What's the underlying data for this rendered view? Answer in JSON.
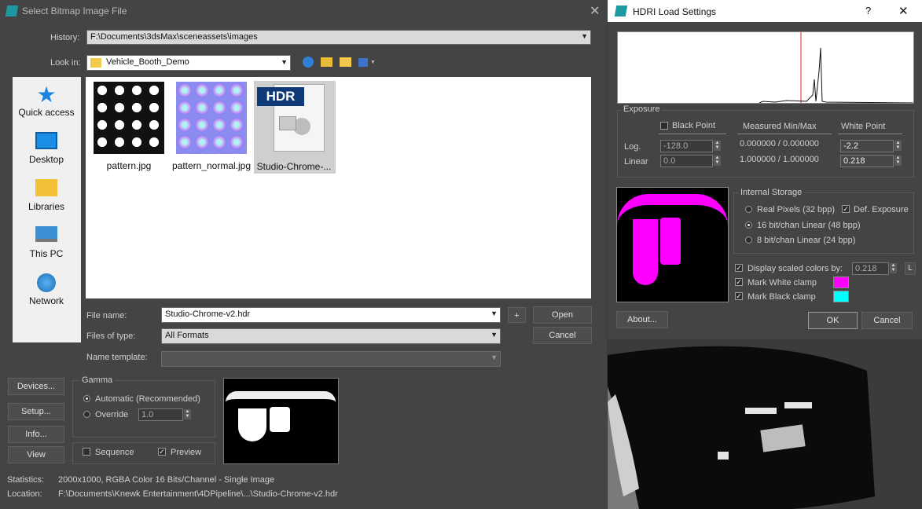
{
  "file_dialog": {
    "title": "Select Bitmap Image File",
    "history_label": "History:",
    "history_value": "F:\\Documents\\3dsMax\\sceneassets\\images",
    "lookin_label": "Look in:",
    "lookin_value": "Vehicle_Booth_Demo",
    "sidebar": [
      {
        "label": "Quick access",
        "icon": "star-icon"
      },
      {
        "label": "Desktop",
        "icon": "desktop-icon"
      },
      {
        "label": "Libraries",
        "icon": "libraries-icon"
      },
      {
        "label": "This PC",
        "icon": "computer-icon"
      },
      {
        "label": "Network",
        "icon": "network-icon"
      }
    ],
    "files": [
      {
        "name": "pattern.jpg"
      },
      {
        "name": "pattern_normal.jpg"
      },
      {
        "name": "Studio-Chrome-...",
        "badge": "HDR"
      }
    ],
    "filename_label": "File name:",
    "filename_value": "Studio-Chrome-v2.hdr",
    "filetype_label": "Files of type:",
    "filetype_value": "All Formats",
    "nametemplate_label": "Name template:",
    "add_label": "+",
    "open_label": "Open",
    "cancel_label": "Cancel",
    "devices_label": "Devices...",
    "setup_label": "Setup...",
    "info_label": "Info...",
    "view_label": "View",
    "gamma": {
      "title": "Gamma",
      "automatic_label": "Automatic (Recommended)",
      "override_label": "Override",
      "override_value": "1.0"
    },
    "sequence_label": "Sequence",
    "preview_label": "Preview",
    "statistics_label": "Statistics:",
    "statistics_value": "2000x1000, RGBA Color 16 Bits/Channel - Single Image",
    "location_label": "Location:",
    "location_value": "F:\\Documents\\Knewk Entertainment\\4DPipeline\\...\\Studio-Chrome-v2.hdr"
  },
  "hdri_dialog": {
    "title": "HDRI Load Settings",
    "help_label": "?",
    "exposure": {
      "title": "Exposure",
      "black_point_label": "Black Point",
      "measured_label": "Measured Min/Max",
      "white_point_label": "White Point",
      "log_label": "Log.",
      "linear_label": "Linear",
      "black_log": "-128.0",
      "black_linear": "0.0",
      "measured_log": "0.000000 / 0.000000",
      "measured_linear": "1.000000 / 1.000000",
      "white_log": "-2.2",
      "white_linear": "0.218"
    },
    "storage": {
      "title": "Internal Storage",
      "options": [
        "Real Pixels (32 bpp)",
        "16 bit/chan Linear (48 bpp)",
        "8 bit/chan Linear (24 bpp)"
      ],
      "def_exposure_label": "Def. Exposure"
    },
    "display_scaled_label": "Display scaled colors by:",
    "display_scaled_value": "0.218",
    "l_label": "L",
    "mark_white_label": "Mark White clamp",
    "mark_black_label": "Mark Black clamp",
    "mark_white_color": "#ff00ff",
    "mark_black_color": "#00ffff",
    "about_label": "About...",
    "ok_label": "OK",
    "cancel_label": "Cancel"
  }
}
